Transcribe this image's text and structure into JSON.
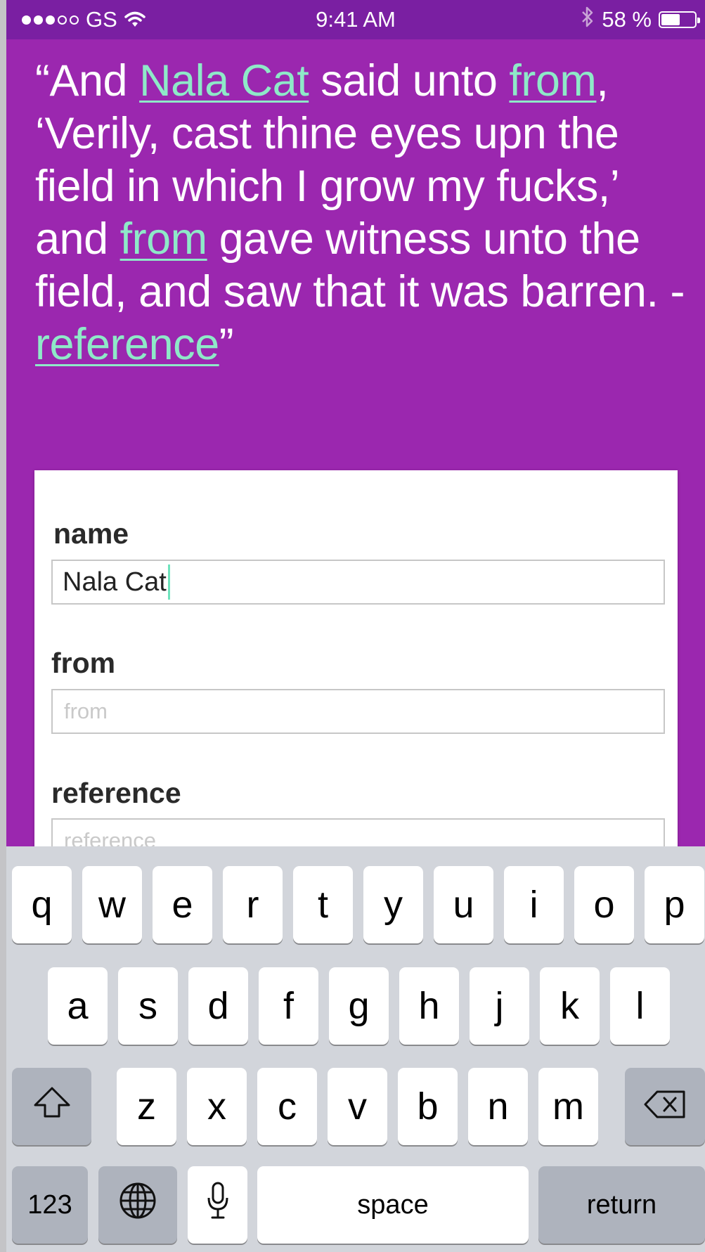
{
  "status_bar": {
    "carrier": "GS",
    "time": "9:41 AM",
    "battery": "58 %",
    "signal_bars": 3,
    "signal_total": 5,
    "battery_level": 0.58,
    "icons": [
      "signal-icon",
      "wifi-icon",
      "bluetooth-icon",
      "battery-icon"
    ]
  },
  "quote": {
    "open": "“And ",
    "name": "Nala Cat",
    "t1": " said unto ",
    "from1": "from",
    "t2": ", ‘Verily, cast thine eyes upn the field in which I grow my fucks,’ and ",
    "from2": "from",
    "t3": " gave witness unto the field, and saw that it was barren. - ",
    "reference": "reference",
    "close": "”"
  },
  "form": {
    "name_label": "name",
    "name_value": "Nala Cat",
    "from_label": "from",
    "from_placeholder": "from",
    "reference_label": "reference",
    "reference_placeholder": "reference"
  },
  "keyboard": {
    "row1": [
      "q",
      "w",
      "e",
      "r",
      "t",
      "y",
      "u",
      "i",
      "o",
      "p"
    ],
    "row2": [
      "a",
      "s",
      "d",
      "f",
      "g",
      "h",
      "j",
      "k",
      "l"
    ],
    "row3": [
      "z",
      "x",
      "c",
      "v",
      "b",
      "n",
      "m"
    ],
    "numbers_label": "123",
    "space_label": "space",
    "return_label": "return",
    "icons": [
      "shift-icon",
      "backspace-icon",
      "globe-icon",
      "microphone-icon"
    ]
  },
  "colors": {
    "background": "#9b27af",
    "status_bar": "#7a1fa2",
    "highlight": "#8ee9c8"
  }
}
